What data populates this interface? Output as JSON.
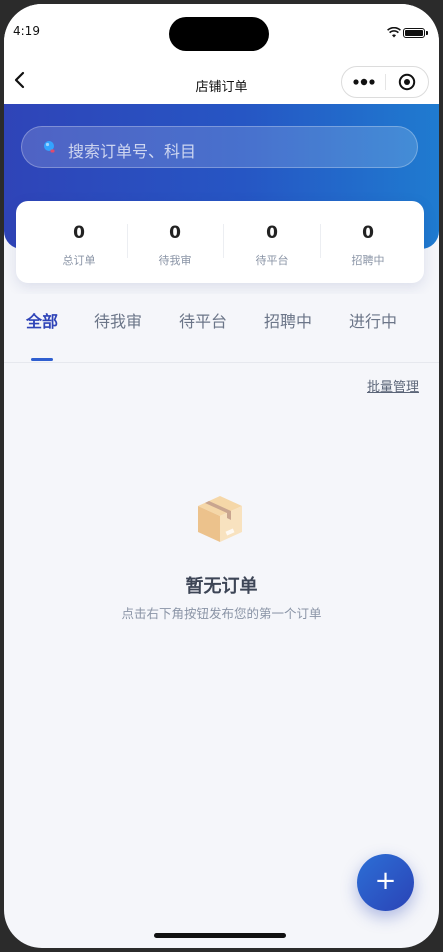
{
  "status_bar": {
    "time": "4:19"
  },
  "nav": {
    "title": "店铺订单",
    "more_icon": "more-dots-icon",
    "close_icon": "target-circle-icon"
  },
  "search": {
    "placeholder": "搜索订单号、科目"
  },
  "stats": [
    {
      "value": "0",
      "label": "总订单"
    },
    {
      "value": "0",
      "label": "待我审"
    },
    {
      "value": "0",
      "label": "待平台"
    },
    {
      "value": "0",
      "label": "招聘中"
    }
  ],
  "tabs": [
    {
      "label": "全部",
      "active": true
    },
    {
      "label": "待我审",
      "active": false
    },
    {
      "label": "待平台",
      "active": false
    },
    {
      "label": "招聘中",
      "active": false
    },
    {
      "label": "进行中",
      "active": false
    }
  ],
  "batch_label": "批量管理",
  "empty": {
    "title": "暂无订单",
    "subtitle": "点击右下角按钮发布您的第一个订单",
    "icon": "package-box-icon"
  },
  "fab": {
    "label": "+"
  },
  "colors": {
    "primary": "#2f44b8",
    "accent": "#1f7bd0",
    "background": "#f5f6fa"
  }
}
